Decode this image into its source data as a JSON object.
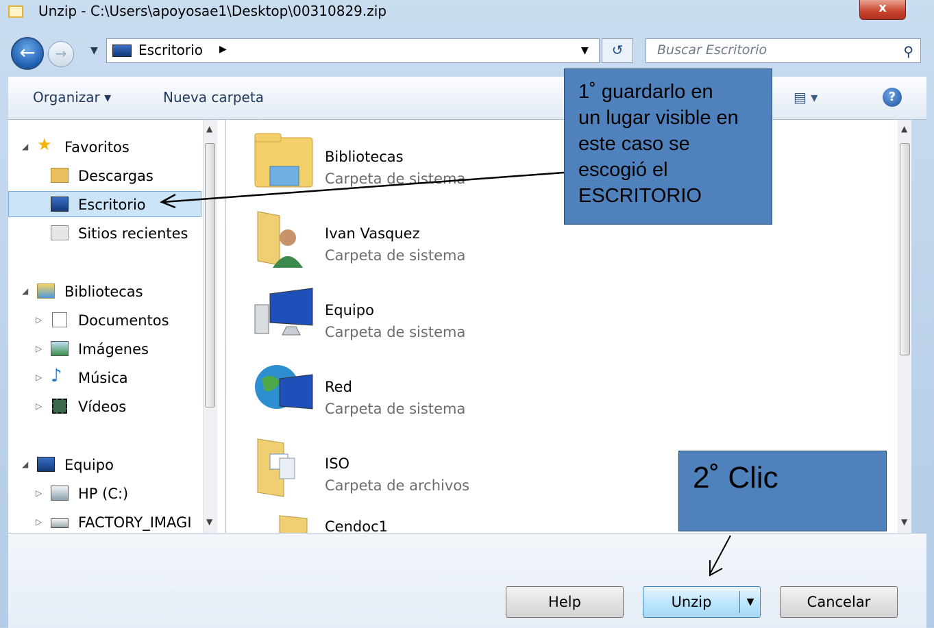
{
  "window": {
    "title": "Unzip - C:\\Users\\apoyosae1\\Desktop\\00310829.zip",
    "close_label": "x"
  },
  "nav": {
    "address_location": "Escritorio",
    "search_placeholder": "Buscar Escritorio"
  },
  "toolbar": {
    "organize_label": "Organizar ▾",
    "new_folder_label": "Nueva carpeta"
  },
  "sidebar": {
    "favorites": {
      "label": "Favoritos",
      "items": [
        {
          "label": "Descargas"
        },
        {
          "label": "Escritorio",
          "selected": true
        },
        {
          "label": "Sitios recientes"
        }
      ]
    },
    "libraries": {
      "label": "Bibliotecas",
      "items": [
        {
          "label": "Documentos"
        },
        {
          "label": "Imágenes"
        },
        {
          "label": "Música"
        },
        {
          "label": "Vídeos"
        }
      ]
    },
    "computer": {
      "label": "Equipo",
      "items": [
        {
          "label": "HP (C:)"
        },
        {
          "label": "FACTORY_IMAGI"
        }
      ]
    }
  },
  "files": [
    {
      "name": "Bibliotecas",
      "type": "Carpeta de sistema",
      "icon": "libraries-folder-icon"
    },
    {
      "name": "Ivan Vasquez",
      "type": "Carpeta de sistema",
      "icon": "user-folder-icon"
    },
    {
      "name": "Equipo",
      "type": "Carpeta de sistema",
      "icon": "computer-icon"
    },
    {
      "name": "Red",
      "type": "Carpeta de sistema",
      "icon": "network-icon"
    },
    {
      "name": "ISO",
      "type": "Carpeta de archivos",
      "icon": "folder-icon"
    },
    {
      "name": "Cendoc1",
      "type": "",
      "icon": "folder-icon"
    }
  ],
  "buttons": {
    "help": "Help",
    "unzip": "Unzip",
    "cancel": "Cancelar"
  },
  "annotations": {
    "step1_line1": "1˚  guardarlo en",
    "step1_line2": "un lugar visible en",
    "step1_line3": "este caso se",
    "step1_line4": "escogió el",
    "step1_line5": "ESCRITORIO",
    "step2": "2˚  Clic"
  },
  "colors": {
    "callout_fill": "#4f81bd",
    "selection": "#cce4f7",
    "primary_button": "#bee6fd"
  }
}
